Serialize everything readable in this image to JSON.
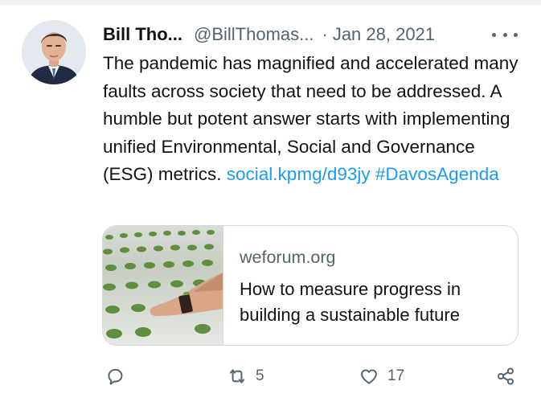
{
  "tweet": {
    "author_name": "Bill Tho...",
    "handle": "@BillThomas...",
    "separator": "·",
    "date": "Jan 28, 2021",
    "text": "The pandemic has magnified and accelerated many faults across society that need to be addressed. A humble but potent answer starts with implementing unified Environmental, Social and Governance (ESG) metrics.",
    "link": "social.kpmg/d93jy",
    "hashtag": "#DavosAgenda"
  },
  "card": {
    "domain": "weforum.org",
    "title": "How to measure progress in building a sustainable future"
  },
  "actions": {
    "reply_icon": "reply-icon",
    "retweet_icon": "retweet-icon",
    "retweet_count": "5",
    "like_icon": "heart-icon",
    "like_count": "17",
    "share_icon": "share-icon"
  },
  "colors": {
    "text": "#0f1419",
    "secondary": "#536471",
    "link": "#1d9bf0",
    "border": "#cfd9de"
  }
}
